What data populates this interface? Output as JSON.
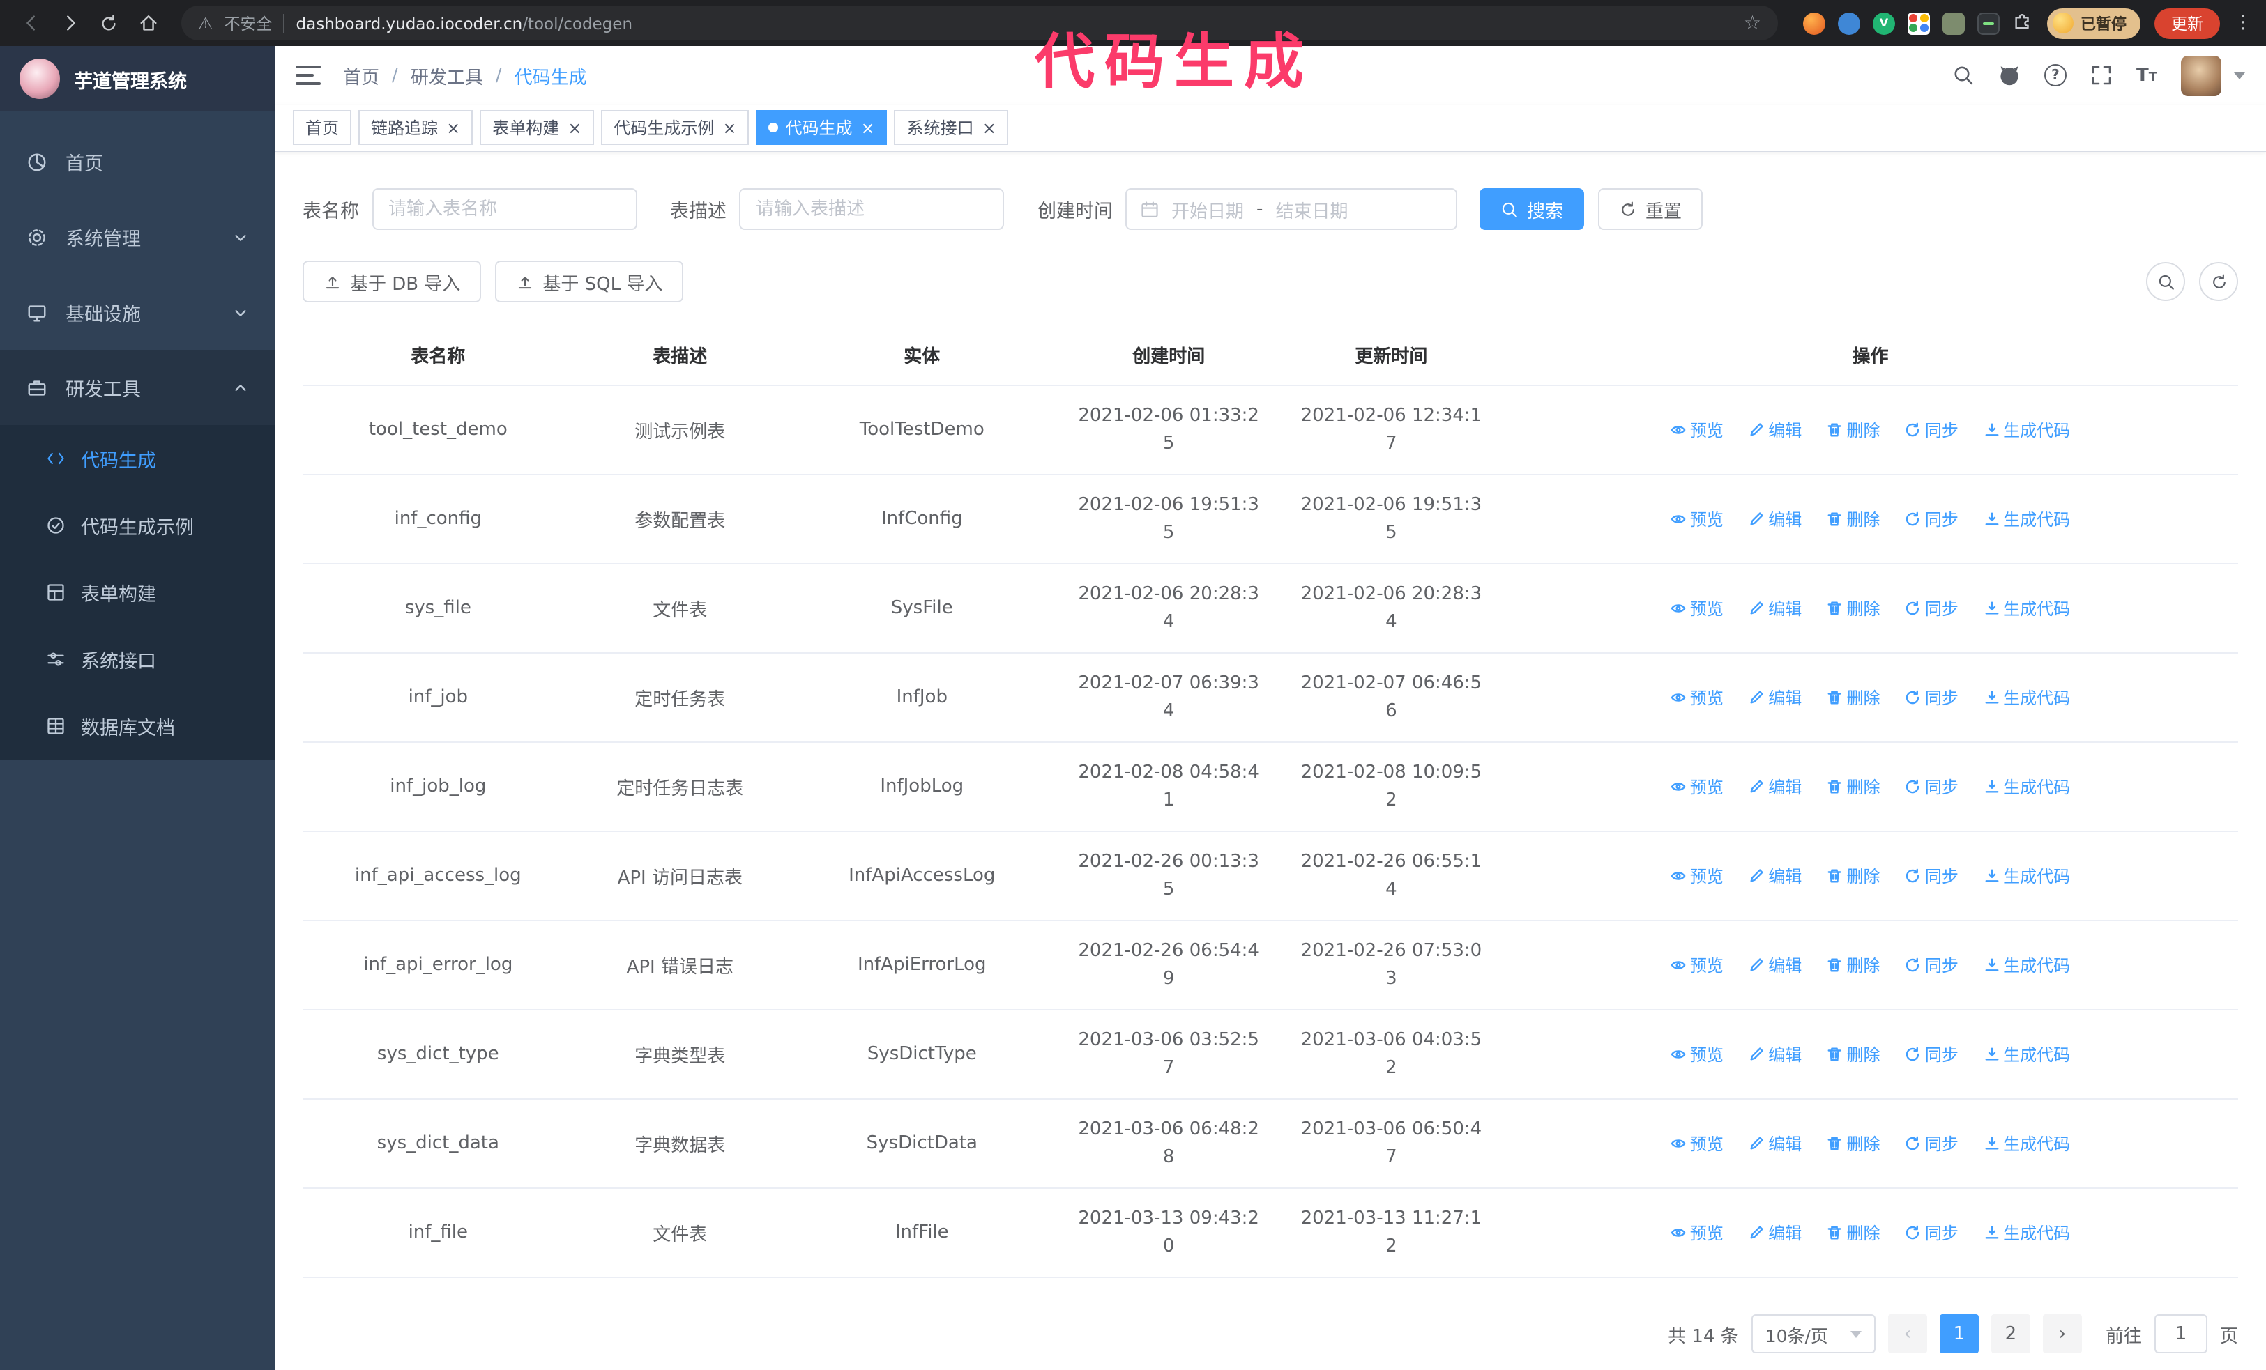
{
  "annotation": {
    "text": "代码生成",
    "color": "#fb3b6a"
  },
  "browser": {
    "security_label": "不安全",
    "url_host": "dashboard.yudao.iocoder.cn",
    "url_path": "/tool/codegen",
    "paused_badge": "已暂停",
    "update_button": "更新"
  },
  "colors": {
    "primary": "#409eff",
    "sidebar_bg": "#304156",
    "submenu_bg": "#1f2d3d",
    "chrome_bg": "#202124",
    "update_button_bg": "#d9432f"
  },
  "sidebar": {
    "logo_title": "芋道管理系统",
    "items": [
      {
        "label": "首页"
      },
      {
        "label": "系统管理"
      },
      {
        "label": "基础设施"
      },
      {
        "label": "研发工具"
      }
    ],
    "subitems": [
      {
        "label": "代码生成"
      },
      {
        "label": "代码生成示例"
      },
      {
        "label": "表单构建"
      },
      {
        "label": "系统接口"
      },
      {
        "label": "数据库文档"
      }
    ]
  },
  "header": {
    "breadcrumb": [
      "首页",
      "研发工具",
      "代码生成"
    ]
  },
  "tabs": [
    {
      "label": "首页"
    },
    {
      "label": "链路追踪"
    },
    {
      "label": "表单构建"
    },
    {
      "label": "代码生成示例"
    },
    {
      "label": "代码生成"
    },
    {
      "label": "系统接口"
    }
  ],
  "filters": {
    "table_name_label": "表名称",
    "table_name_placeholder": "请输入表名称",
    "table_desc_label": "表描述",
    "table_desc_placeholder": "请输入表描述",
    "create_time_label": "创建时间",
    "start_date_placeholder": "开始日期",
    "range_separator": "-",
    "end_date_placeholder": "结束日期",
    "search_label": "搜索",
    "reset_label": "重置"
  },
  "toolbar": {
    "import_db_label": "基于 DB 导入",
    "import_sql_label": "基于 SQL 导入"
  },
  "table": {
    "columns": [
      "表名称",
      "表描述",
      "实体",
      "创建时间",
      "更新时间",
      "操作"
    ],
    "actions": [
      "预览",
      "编辑",
      "删除",
      "同步",
      "生成代码"
    ],
    "rows": [
      {
        "name": "tool_test_demo",
        "desc": "测试示例表",
        "entity": "ToolTestDemo",
        "created": "2021-02-06 01:33:25",
        "updated": "2021-02-06 12:34:17"
      },
      {
        "name": "inf_config",
        "desc": "参数配置表",
        "entity": "InfConfig",
        "created": "2021-02-06 19:51:35",
        "updated": "2021-02-06 19:51:35"
      },
      {
        "name": "sys_file",
        "desc": "文件表",
        "entity": "SysFile",
        "created": "2021-02-06 20:28:34",
        "updated": "2021-02-06 20:28:34"
      },
      {
        "name": "inf_job",
        "desc": "定时任务表",
        "entity": "InfJob",
        "created": "2021-02-07 06:39:34",
        "updated": "2021-02-07 06:46:56"
      },
      {
        "name": "inf_job_log",
        "desc": "定时任务日志表",
        "entity": "InfJobLog",
        "created": "2021-02-08 04:58:41",
        "updated": "2021-02-08 10:09:52"
      },
      {
        "name": "inf_api_access_log",
        "desc": "API 访问日志表",
        "entity": "InfApiAccessLog",
        "created": "2021-02-26 00:13:35",
        "updated": "2021-02-26 06:55:14"
      },
      {
        "name": "inf_api_error_log",
        "desc": "API 错误日志",
        "entity": "InfApiErrorLog",
        "created": "2021-02-26 06:54:49",
        "updated": "2021-02-26 07:53:03"
      },
      {
        "name": "sys_dict_type",
        "desc": "字典类型表",
        "entity": "SysDictType",
        "created": "2021-03-06 03:52:57",
        "updated": "2021-03-06 04:03:52"
      },
      {
        "name": "sys_dict_data",
        "desc": "字典数据表",
        "entity": "SysDictData",
        "created": "2021-03-06 06:48:28",
        "updated": "2021-03-06 06:50:47"
      },
      {
        "name": "inf_file",
        "desc": "文件表",
        "entity": "InfFile",
        "created": "2021-03-13 09:43:20",
        "updated": "2021-03-13 11:27:12"
      }
    ]
  },
  "pagination": {
    "total": "共 14 条",
    "page_size": "10条/页",
    "pages": [
      "1",
      "2"
    ],
    "goto_label": "前往",
    "goto_value": "1",
    "page_unit": "页"
  }
}
